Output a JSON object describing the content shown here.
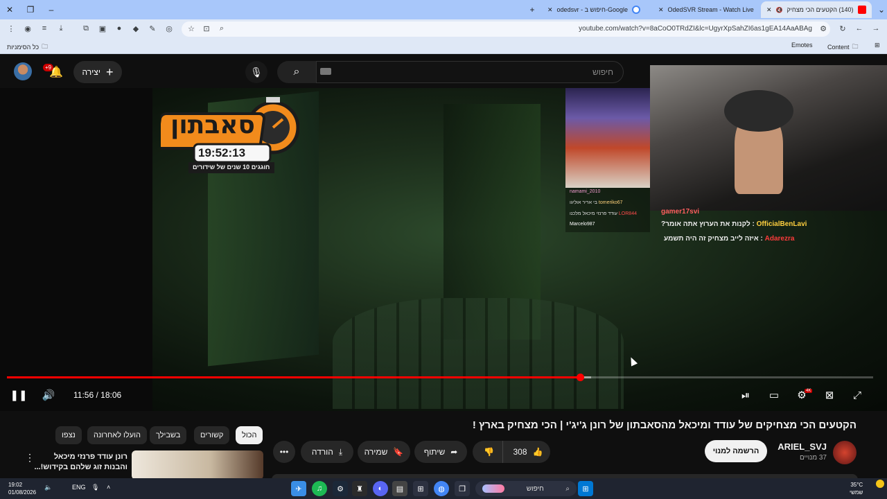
{
  "browser": {
    "tabs": [
      {
        "title": "(140) הקטעים הכי מצחיקים",
        "favicon_color": "#ff0000",
        "active": true
      },
      {
        "title": "OdedSVR Stream - Watch Live",
        "favicon_color": "#53fc18",
        "active": false
      },
      {
        "title": "odedsvr - חיפוש ב-Google",
        "favicon_color": "#4285f4",
        "active": false
      }
    ],
    "url": "youtube.com/watch?v=8aCoO0TRdZI&lc=UgyrXpSahZI6as1gEA14AaABAg",
    "bookmarks": {
      "all_bookmarks": "כל הסימניות",
      "emotes": "Emotes",
      "content": "Content"
    }
  },
  "youtube": {
    "search_placeholder": "חיפוש",
    "create_label": "יצירה",
    "notif_count": "+9",
    "video": {
      "logo_title": "סאבתון",
      "logo_timer": "19:52:13",
      "logo_sub": "חוגגים 10 שנים של שידורים",
      "chat_small": [
        {
          "user": "namami_2010",
          "msg": ""
        },
        {
          "user": "tomeriko67",
          "msg": "בי אריר אוליגו"
        },
        {
          "user": "LOR844",
          "msg": "עודד פרנזי מיכאל מלכנו"
        },
        {
          "user": "Marcelo987",
          "msg": ""
        }
      ],
      "chat_big": [
        {
          "user": "gamer17svi",
          "msg": ""
        },
        {
          "user": "OfficialBenLavi",
          "msg": "לקנות את הערוץ אתה אומר?"
        },
        {
          "user": "Adarezra",
          "msg": "איזה לייב מצחיק זה היה תשמע"
        }
      ],
      "time_current": "11:56",
      "time_total": "18:06",
      "progress": 0.6617,
      "buffered": 0.6742,
      "hd_badge": "4K"
    },
    "title": "הקטעים הכי מצחיקים של עודד ומיכאל מהסאבתון של רונן ג'יג'י | הכי מצחיק בארץ !",
    "channel": {
      "name": "ARIEL_SVJ",
      "subs": "37 מנויים",
      "subscribe_label": "הרשמה למנוי"
    },
    "actions": {
      "likes": "308",
      "share": "שיתוף",
      "save": "שמירה",
      "download": "הורדה"
    },
    "chips": [
      "הכול",
      "קשורים",
      "בשבילך",
      "הועלו לאחרונה",
      "נצפו"
    ],
    "recommendation": {
      "title": "רונן עודד פרנזי מיכאל והבנות זוג שלהם בקידוש!..."
    }
  },
  "taskbar": {
    "search": "חיפוש",
    "time": "19:02",
    "date": "01/08/2026",
    "lang": "ENG",
    "temp": "35°C",
    "weather": "שמשי"
  }
}
